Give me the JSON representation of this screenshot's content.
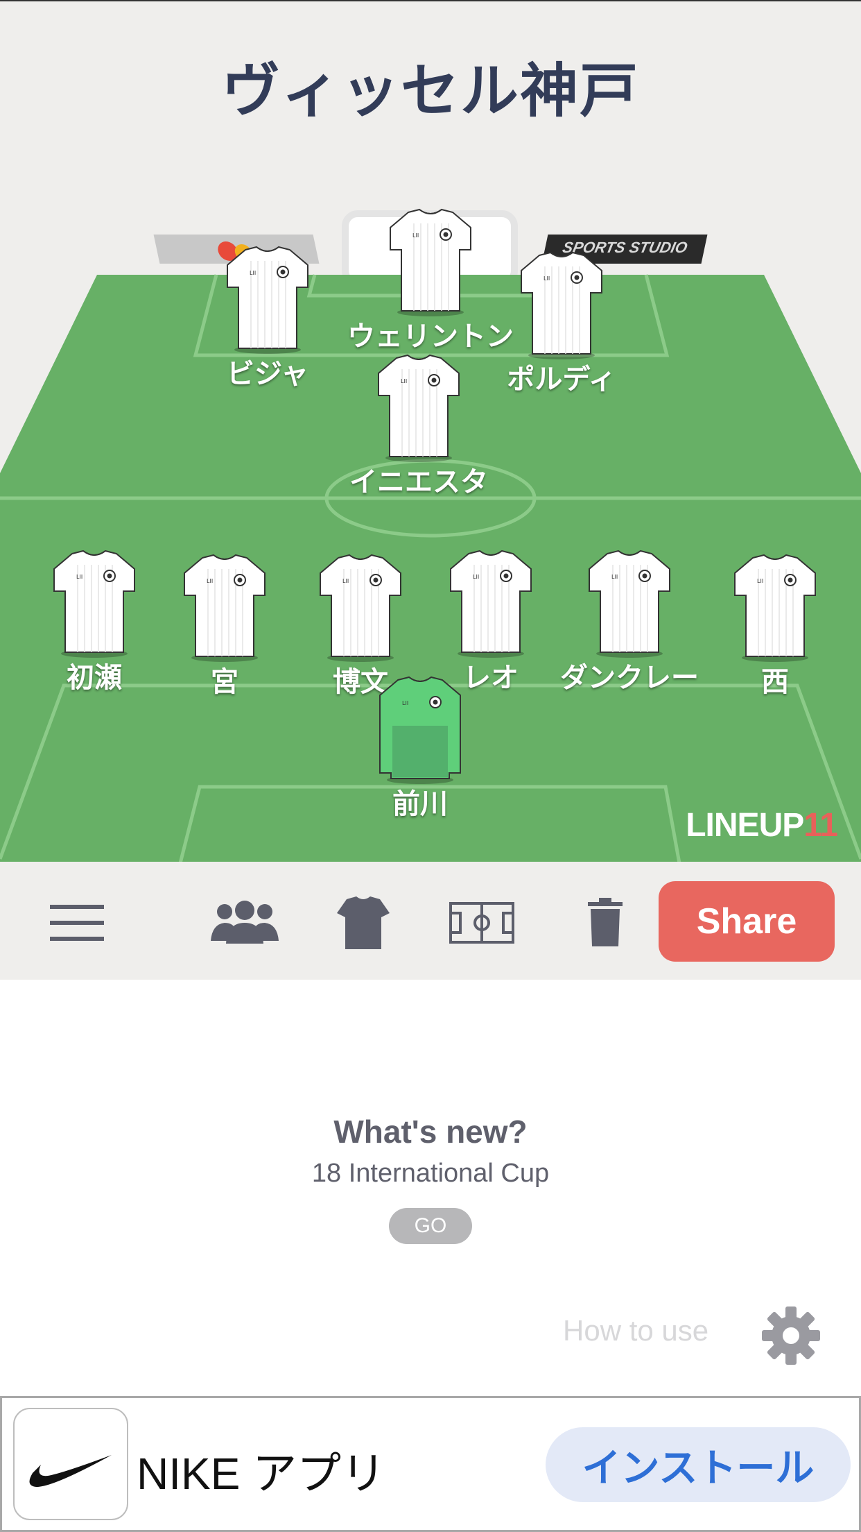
{
  "team_name": "ヴィッセル神戸",
  "pitch": {
    "ad_right_text": "SPORTS STUDIO",
    "brand": {
      "part1": "LINEUP",
      "part2": "11"
    }
  },
  "players": [
    {
      "name": "ウェリントン",
      "kit": "outfield"
    },
    {
      "name": "ビジャ",
      "kit": "outfield"
    },
    {
      "name": "ポルディ",
      "kit": "outfield"
    },
    {
      "name": "イニエスタ",
      "kit": "outfield"
    },
    {
      "name": "初瀬",
      "kit": "outfield"
    },
    {
      "name": "宮",
      "kit": "outfield"
    },
    {
      "name": "博文",
      "kit": "outfield"
    },
    {
      "name": "レオ",
      "kit": "outfield"
    },
    {
      "name": "ダンクレー",
      "kit": "outfield"
    },
    {
      "name": "西",
      "kit": "outfield"
    },
    {
      "name": "前川",
      "kit": "goalkeeper"
    }
  ],
  "toolbar": {
    "menu_icon": "hamburger-icon",
    "players_icon": "people-icon",
    "kit_icon": "shirt-icon",
    "formation_icon": "pitch-icon",
    "delete_icon": "trash-icon",
    "share_label": "Share"
  },
  "whats_new": {
    "title": "What's new?",
    "subtitle": "18 International Cup",
    "go_label": "GO"
  },
  "how_to_use": "How to use",
  "ad": {
    "title": "NIKE アプリ",
    "install_label": "インストール"
  },
  "colors": {
    "pitch": "#67b066",
    "pitch_lines": "#8ccb89",
    "title": "#323c58",
    "share": "#e8675f",
    "brand_accent": "#e8615a"
  }
}
